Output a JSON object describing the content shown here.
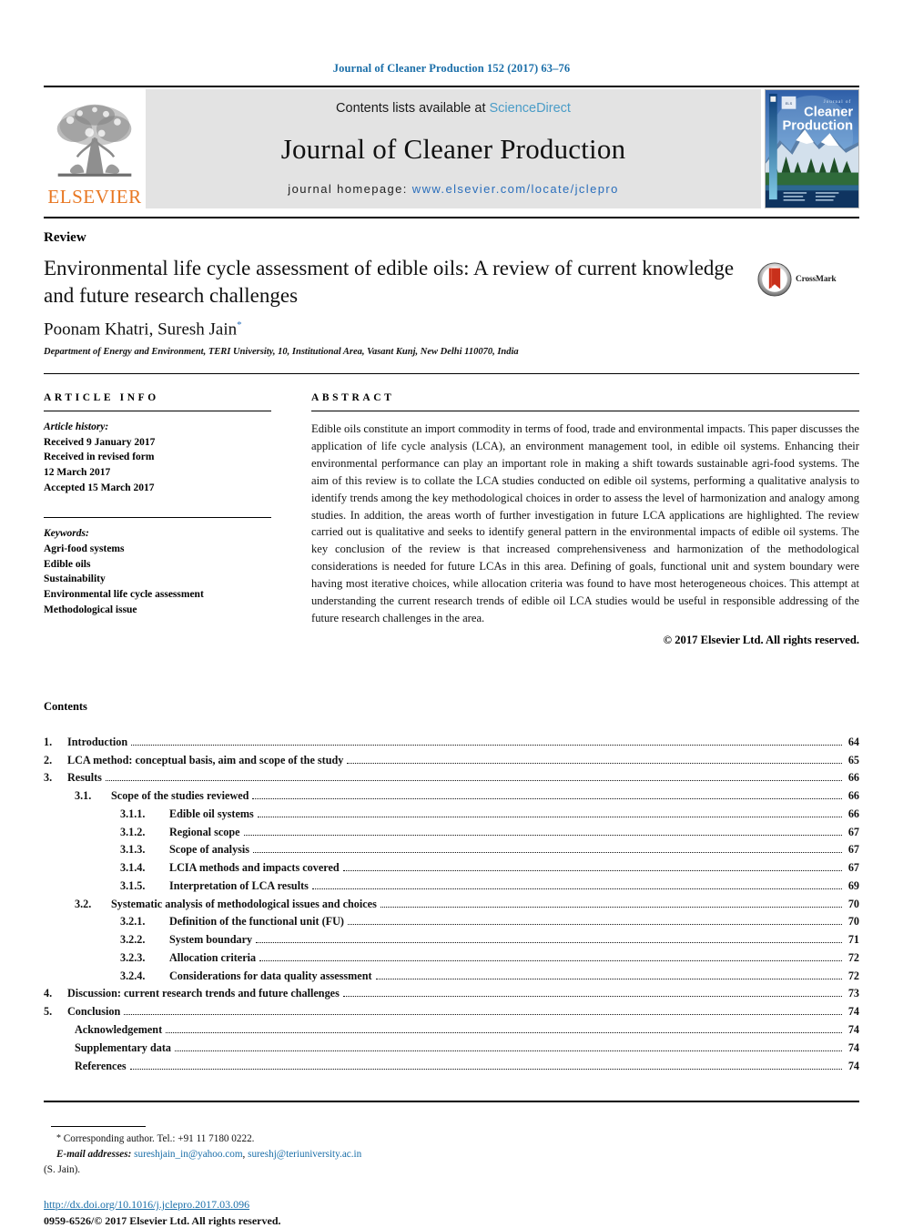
{
  "running_head": "Journal of Cleaner Production 152 (2017) 63–76",
  "masthead": {
    "contents_prefix": "Contents lists available at ",
    "sciencedirect": "ScienceDirect",
    "journal_title": "Journal of Cleaner Production",
    "homepage_prefix": "journal homepage: ",
    "homepage_url": "www.elsevier.com/locate/jclepro",
    "publisher_wordmark": "ELSEVIER",
    "cover_title_line1": "Journal of",
    "cover_title_line2": "Cleaner",
    "cover_title_line3": "Production",
    "link_color": "#4a9cc7",
    "url_color": "#2a6ebb",
    "elsevier_orange": "#e87722",
    "band_color": "#e3e3e3"
  },
  "article": {
    "type": "Review",
    "title": "Environmental life cycle assessment of edible oils: A review of current knowledge and future research challenges",
    "authors": "Poonam Khatri, Suresh Jain",
    "author_marker": "*",
    "affiliation": "Department of Energy and Environment, TERI University, 10, Institutional Area, Vasant Kunj, New Delhi 110070, India",
    "crossmark_label": "CrossMark"
  },
  "article_info": {
    "heading": "ARTICLE INFO",
    "history_label": "Article history:",
    "history_lines": [
      "Received 9 January 2017",
      "Received in revised form",
      "12 March 2017",
      "Accepted 15 March 2017"
    ],
    "keywords_label": "Keywords:",
    "keywords": [
      "Agri-food systems",
      "Edible oils",
      "Sustainability",
      "Environmental life cycle assessment",
      "Methodological issue"
    ]
  },
  "abstract": {
    "heading": "ABSTRACT",
    "text": "Edible oils constitute an import commodity in terms of food, trade and environmental impacts. This paper discusses the application of life cycle analysis (LCA), an environment management tool, in edible oil systems. Enhancing their environmental performance can play an important role in making a shift towards sustainable agri-food systems. The aim of this review is to collate the LCA studies conducted on edible oil systems, performing a qualitative analysis to identify trends among the key methodological choices in order to assess the level of harmonization and analogy among studies. In addition, the areas worth of further investigation in future LCA applications are highlighted. The review carried out is qualitative and seeks to identify general pattern in the environmental impacts of edible oil systems. The key conclusion of the review is that increased comprehensiveness and harmonization of the methodological considerations is needed for future LCAs in this area. Defining of goals, functional unit and system boundary were having most iterative choices, while allocation criteria was found to have most heterogeneous choices. This attempt at understanding the current research trends of edible oil LCA studies would be useful in responsible addressing of the future research challenges in the area.",
    "copyright": "© 2017 Elsevier Ltd. All rights reserved."
  },
  "contents": {
    "heading": "Contents",
    "entries": [
      {
        "level": 1,
        "num": "1.",
        "label": "Introduction",
        "page": "64"
      },
      {
        "level": 1,
        "num": "2.",
        "label": "LCA method: conceptual basis, aim and scope of the study",
        "page": "65"
      },
      {
        "level": 1,
        "num": "3.",
        "label": "Results",
        "page": "66"
      },
      {
        "level": 2,
        "num": "3.1.",
        "label": "Scope of the studies reviewed",
        "page": "66"
      },
      {
        "level": 3,
        "num": "3.1.1.",
        "label": "Edible oil systems",
        "page": "66"
      },
      {
        "level": 3,
        "num": "3.1.2.",
        "label": "Regional scope",
        "page": "67"
      },
      {
        "level": 3,
        "num": "3.1.3.",
        "label": "Scope of analysis",
        "page": "67"
      },
      {
        "level": 3,
        "num": "3.1.4.",
        "label": "LCIA methods and impacts covered",
        "page": "67"
      },
      {
        "level": 3,
        "num": "3.1.5.",
        "label": "Interpretation of LCA results",
        "page": "69"
      },
      {
        "level": 2,
        "num": "3.2.",
        "label": "Systematic analysis of methodological issues and choices",
        "page": "70"
      },
      {
        "level": 3,
        "num": "3.2.1.",
        "label": "Definition of the functional unit (FU)",
        "page": "70"
      },
      {
        "level": 3,
        "num": "3.2.2.",
        "label": "System boundary",
        "page": "71"
      },
      {
        "level": 3,
        "num": "3.2.3.",
        "label": "Allocation criteria",
        "page": "72"
      },
      {
        "level": 3,
        "num": "3.2.4.",
        "label": "Considerations for data quality assessment",
        "page": "72"
      },
      {
        "level": 1,
        "num": "4.",
        "label": "Discussion: current research trends and future challenges",
        "page": "73"
      },
      {
        "level": 1,
        "num": "5.",
        "label": "Conclusion",
        "page": "74"
      },
      {
        "level": 0,
        "num": "",
        "label": "Acknowledgement",
        "page": "74"
      },
      {
        "level": 0,
        "num": "",
        "label": "Supplementary data",
        "page": "74"
      },
      {
        "level": 0,
        "num": "",
        "label": "References",
        "page": "74"
      }
    ]
  },
  "footer": {
    "corresponding_marker": "*",
    "corresponding_text": "Corresponding author. Tel.: +91 11 7180 0222.",
    "email_label": "E-mail addresses:",
    "email1": "sureshjain_in@yahoo.com",
    "email_sep": ", ",
    "email2": "sureshj@teriuniversity.ac.in",
    "email_attrib": "(S. Jain).",
    "doi": "http://dx.doi.org/10.1016/j.jclepro.2017.03.096",
    "issn_line": "0959-6526/© 2017 Elsevier Ltd. All rights reserved."
  }
}
